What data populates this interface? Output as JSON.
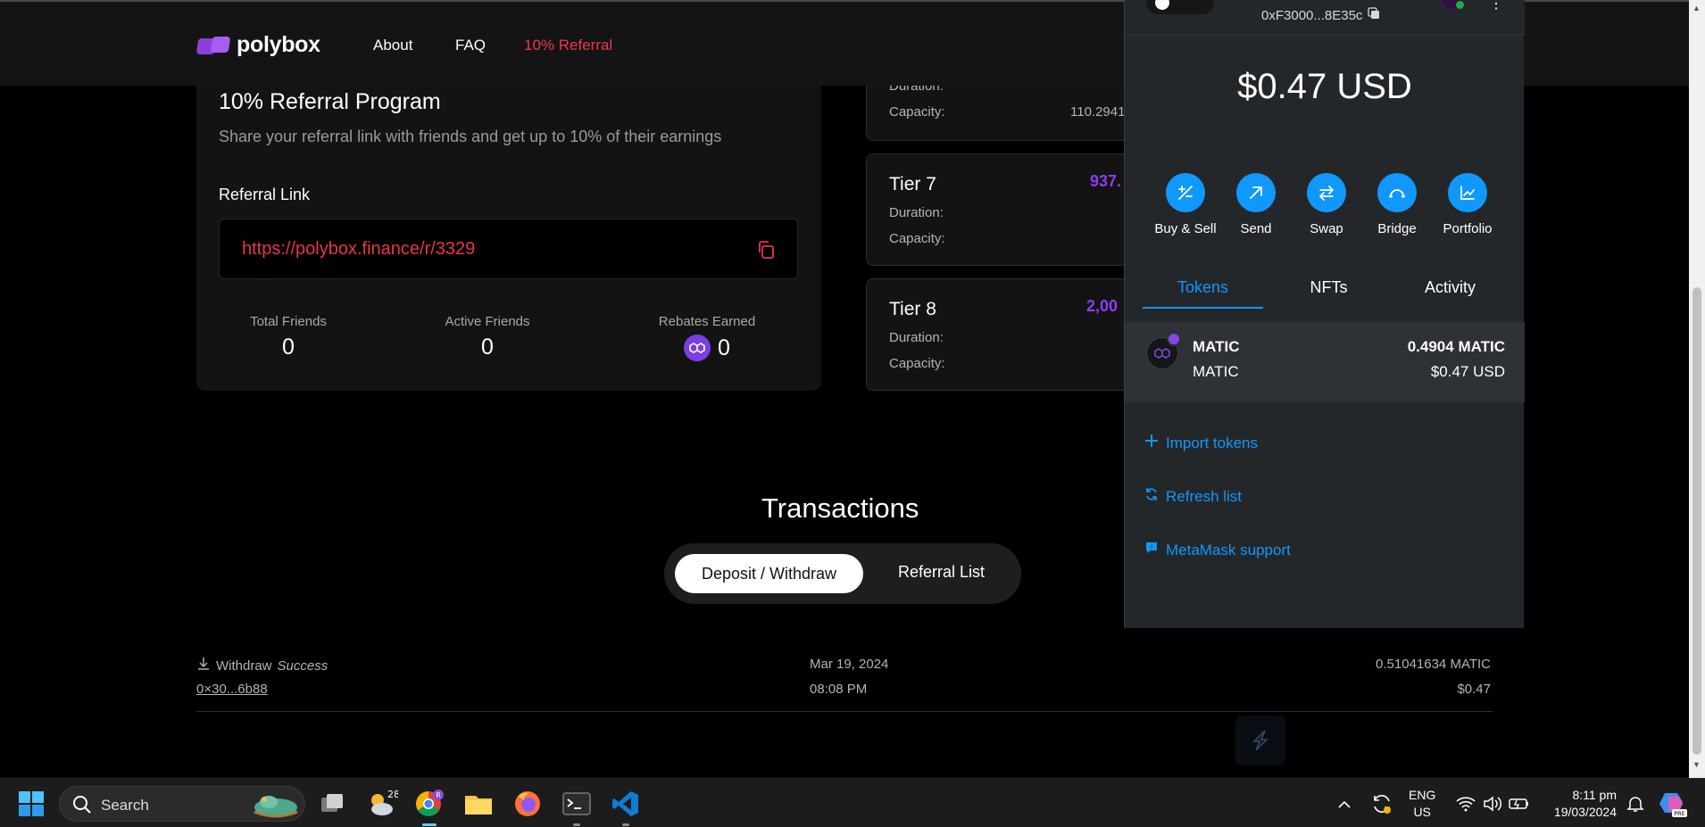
{
  "nav": {
    "logo_text": "polybox",
    "links": [
      "About",
      "FAQ",
      "10% Referral"
    ]
  },
  "referral": {
    "title": "10% Referral Program",
    "subtitle": "Share your referral link with friends and get up to 10% of their earnings",
    "link_label": "Referral Link",
    "link_url": "https://polybox.finance/r/3329",
    "stats": [
      {
        "label": "Total Friends",
        "value": "0"
      },
      {
        "label": "Active Friends",
        "value": "0"
      },
      {
        "label": "Rebates Earned",
        "value": "0"
      }
    ]
  },
  "tiers": {
    "partial": {
      "duration_label": "Duration:",
      "capacity_label": "Capacity:",
      "capacity_value": "110.2941"
    },
    "tier7": {
      "name": "Tier 7",
      "amount": "937.",
      "duration_label": "Duration:",
      "capacity_label": "Capacity:"
    },
    "tier8": {
      "name": "Tier 8",
      "amount": "2,00",
      "duration_label": "Duration:",
      "capacity_label": "Capacity:"
    }
  },
  "transactions": {
    "title": "Transactions",
    "tabs": [
      "Deposit / Withdraw",
      "Referral List"
    ],
    "rows": [
      {
        "type": "Withdraw",
        "status": "Success",
        "hash": "0×30...6b88",
        "date": "Mar 19, 2024",
        "time": "08:08 PM",
        "amount": "0.51041634 MATIC",
        "usd": "$0.47"
      }
    ]
  },
  "metamask": {
    "address": "0xF3000...8E35c",
    "balance": "$0.47 USD",
    "actions": [
      {
        "label": "Buy & Sell",
        "icon": "buy-sell-icon"
      },
      {
        "label": "Send",
        "icon": "send-arrow-icon"
      },
      {
        "label": "Swap",
        "icon": "swap-icon"
      },
      {
        "label": "Bridge",
        "icon": "bridge-icon"
      },
      {
        "label": "Portfolio",
        "icon": "portfolio-chart-icon"
      }
    ],
    "tabs": [
      "Tokens",
      "NFTs",
      "Activity"
    ],
    "token": {
      "name": "MATIC",
      "symbol": "MATIC",
      "amount": "0.4904 MATIC",
      "usd": "$0.47 USD"
    },
    "links": [
      "Import tokens",
      "Refresh list",
      "MetaMask support"
    ],
    "accent": "#1098fc"
  },
  "taskbar": {
    "search_placeholder": "Search",
    "weather_temp": "28°",
    "chrome_badge": "R",
    "lang_line1": "ENG",
    "lang_line2": "US",
    "time": "8:11 pm",
    "date": "19/03/2024",
    "copilot_badge": "PRE"
  },
  "colors": {
    "referral_red": "#f0364f",
    "purple": "#8b3df0"
  }
}
